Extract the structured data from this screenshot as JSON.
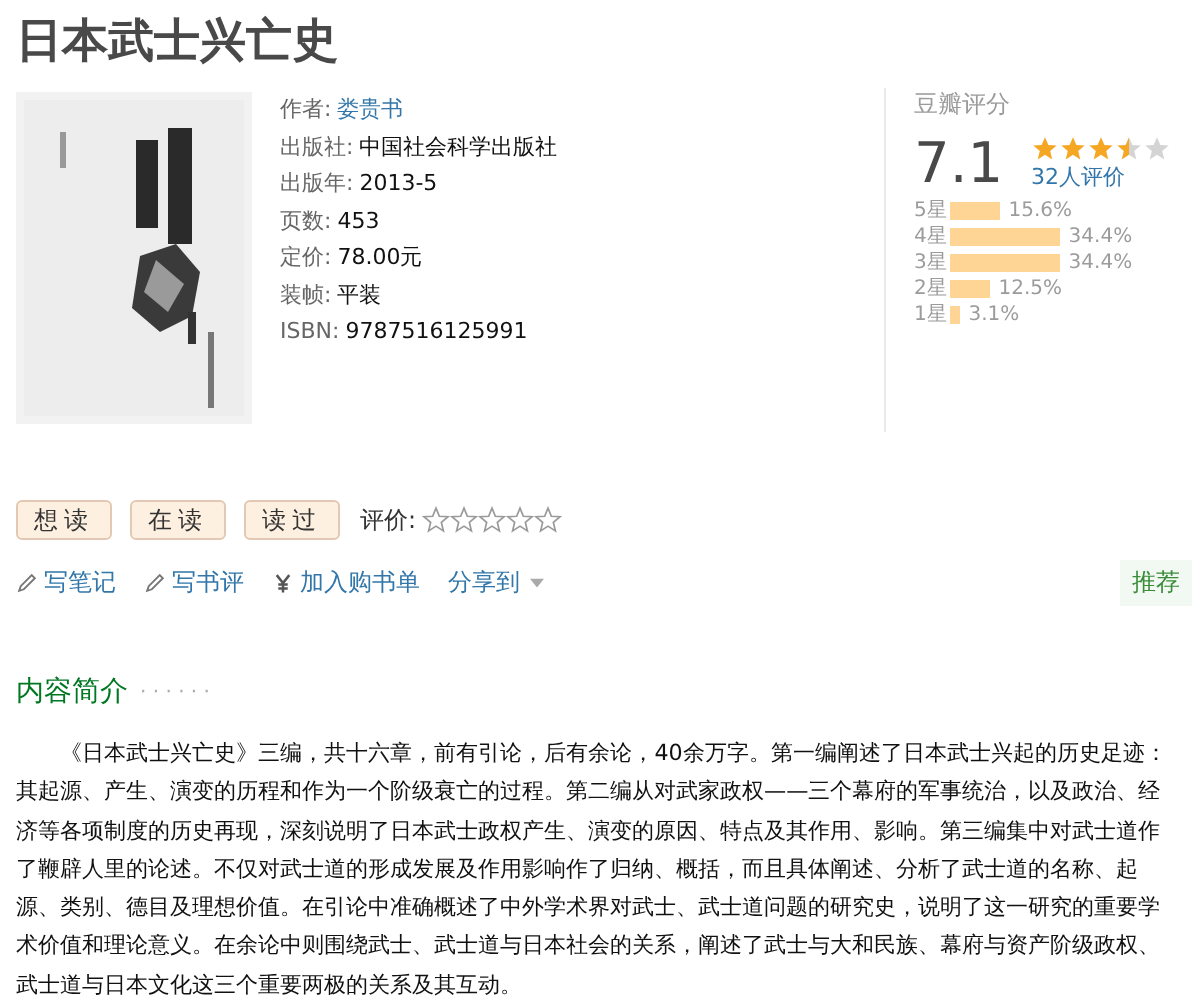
{
  "title": "日本武士兴亡史",
  "cover": {
    "kind": "picture"
  },
  "info": [
    {
      "label": "作者:",
      "value": "娄贵书",
      "link": true
    },
    {
      "label": "出版社:",
      "value": "中国社会科学出版社",
      "link": false
    },
    {
      "label": "出版年:",
      "value": "2013-5",
      "link": false
    },
    {
      "label": "页数:",
      "value": "453",
      "link": false
    },
    {
      "label": "定价:",
      "value": "78.00元",
      "link": false
    },
    {
      "label": "装帧:",
      "value": "平装",
      "link": false
    },
    {
      "label": "ISBN:",
      "value": "9787516125991",
      "link": false
    }
  ],
  "rating": {
    "heading": "豆瓣评分",
    "score": "7.1",
    "stars": 3.5,
    "count": "32人评价",
    "bars": [
      {
        "label": "5星",
        "percent": "15.6%"
      },
      {
        "label": "4星",
        "percent": "34.4%"
      },
      {
        "label": "3星",
        "percent": "34.4%"
      },
      {
        "label": "2星",
        "percent": "12.5%"
      },
      {
        "label": "1星",
        "percent": "3.1%"
      }
    ]
  },
  "status_buttons": [
    "想读",
    "在读",
    "读过"
  ],
  "my_rating": {
    "label": "评价:",
    "stars": 0
  },
  "actions": [
    {
      "kind": "pencil",
      "label": "写笔记"
    },
    {
      "kind": "pencil",
      "label": "写书评"
    },
    {
      "kind": "yen",
      "label": "加入购书单"
    },
    {
      "kind": "menu",
      "label": "分享到"
    }
  ],
  "recommend": "推荐",
  "intro": {
    "heading": "内容简介",
    "dots": "· · · · · ·",
    "text": "《日本武士兴亡史》三编，共十六章，前有引论，后有余论，40余万字。第一编阐述了日本武士兴起的历史足迹：其起源、产生、演变的历程和作为一个阶级衰亡的过程。第二编从对武家政权——三个幕府的军事统治，以及政治、经济等各项制度的历史再现，深刻说明了日本武士政权产生、演变的原因、特点及其作用、影响。第三编集中对武士道作了鞭辟人里的论述。不仅对武士道的形成发展及作用影响作了归纳、概括，而且具体阐述、分析了武士道的名称、起源、类别、德目及理想价值。在引论中准确概述了中外学术界对武士、武士道问题的研究史，说明了这一研究的重要学术价值和理论意义。在余论中则围绕武士、武士道与日本社会的关系，阐述了武士与大和民族、幕府与资产阶级政权、武士道与日本文化这三个重要两极的关系及其互动。"
  }
}
